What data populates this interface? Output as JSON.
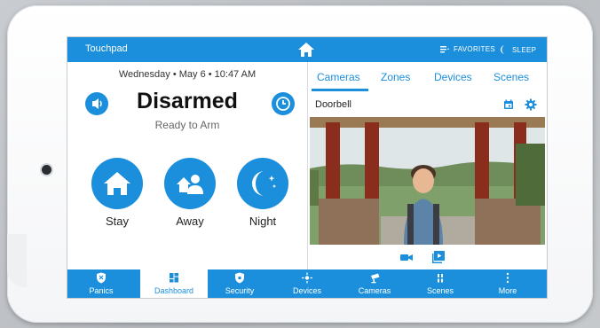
{
  "topbar": {
    "title": "Touchpad",
    "favorites_label": "FAVORITES",
    "sleep_label": "SLEEP"
  },
  "status": {
    "date": "Wednesday  •  May 6  •  10:47 AM",
    "state": "Disarmed",
    "substate": "Ready to Arm"
  },
  "arm_buttons": [
    {
      "label": "Stay",
      "icon": "house-icon"
    },
    {
      "label": "Away",
      "icon": "people-icon"
    },
    {
      "label": "Night",
      "icon": "moon-stars-icon"
    }
  ],
  "tabs": [
    "Cameras",
    "Zones",
    "Devices",
    "Scenes"
  ],
  "active_tab": "Cameras",
  "camera": {
    "title": "Doorbell"
  },
  "nav": [
    {
      "label": "Panics",
      "icon": "shield-icon"
    },
    {
      "label": "Dashboard",
      "icon": "dashboard-icon"
    },
    {
      "label": "Security",
      "icon": "security-icon"
    },
    {
      "label": "Devices",
      "icon": "devices-icon"
    },
    {
      "label": "Cameras",
      "icon": "camera-icon"
    },
    {
      "label": "Scenes",
      "icon": "scenes-icon"
    },
    {
      "label": "More",
      "icon": "more-icon"
    }
  ],
  "active_nav": "Dashboard",
  "colors": {
    "accent": "#1b8fdc",
    "bezel": "#ffffff"
  }
}
